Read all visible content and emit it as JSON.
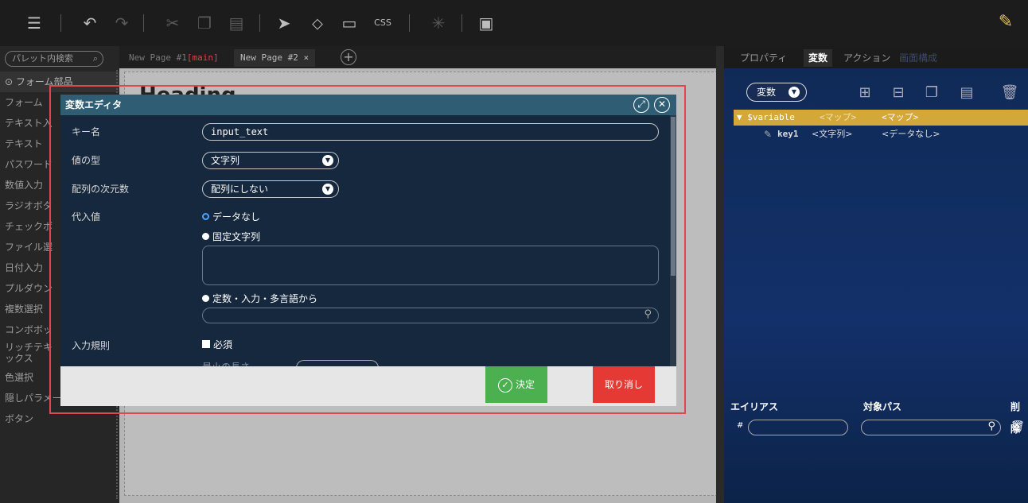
{
  "toolbar": {
    "icons": [
      "database-icon",
      "undo-icon",
      "redo-icon",
      "cut-icon",
      "copy-icon",
      "paste-icon",
      "pointer-icon",
      "cursor-select-icon",
      "monitor-icon",
      "css-icon",
      "sparkle-icon",
      "layout-icon",
      "edit-pencil-icon"
    ]
  },
  "palette": {
    "search_label": "パレット内検索",
    "group_label": "⊙ フォーム部品",
    "items": [
      "フォーム",
      "テキスト入",
      "テキスト",
      "パスワード",
      "数値入力",
      "ラジオボタ",
      "チェックボ",
      "ファイル選",
      "日付入力",
      "プルダウン",
      "複数選択",
      "コンボボッ",
      "リッチテキ\nックス",
      "色選択",
      "隠しパラメータ",
      "ボタン"
    ]
  },
  "pages": {
    "tab1_name": "New Page #1",
    "tab1_suffix": "[main]",
    "tab2_name": "New Page #2 ×",
    "canvas_heading": "Heading"
  },
  "right_panel": {
    "tabs": [
      "プロパティ",
      "変数",
      "アクション",
      "画面構成"
    ],
    "var_select": "変数",
    "tree": {
      "root_key": "▼ $variable",
      "root_type": "<マップ>",
      "root_value": "<マップ>",
      "child_key": "key1",
      "child_type": "<文字列>",
      "child_value": "<データなし>"
    },
    "alias_headers": [
      "エイリアス",
      "対象パス",
      "削除"
    ],
    "alias_prefix": "#"
  },
  "dialog": {
    "title": "変数エディタ",
    "labels": {
      "key_name": "キー名",
      "value_type": "値の型",
      "array_dim": "配列の次元数",
      "assign_value": "代入値",
      "input_rule": "入力規則",
      "min_length": "最小の長さ"
    },
    "key_name_value": "input_text",
    "value_type_value": "文字列",
    "array_dim_value": "配列にしない",
    "radio_options": [
      "データなし",
      "固定文字列",
      "定数・入力・多言語から"
    ],
    "required_label": "必須",
    "ok_label": "決定",
    "cancel_label": "取り消し"
  }
}
